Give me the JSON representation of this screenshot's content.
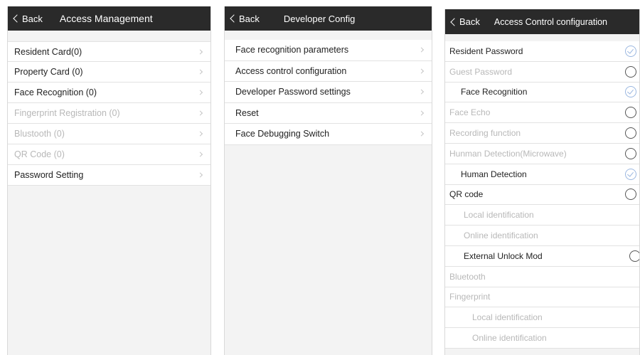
{
  "access_management": {
    "back_label": "Back",
    "title": "Access Management",
    "items": [
      {
        "label": "Resident Card(0)"
      },
      {
        "label": "Property Card (0)"
      },
      {
        "label": "Face Recognition (0)"
      },
      {
        "label": "Fingerprint Registration (0)"
      },
      {
        "label": "Blustooth (0)"
      },
      {
        "label": "QR Code (0)"
      },
      {
        "label": "Password Setting"
      }
    ]
  },
  "developer_config": {
    "back_label": "Back",
    "title": "Developer Config",
    "items": [
      {
        "label": "Face recognition parameters"
      },
      {
        "label": "Access control configuration"
      },
      {
        "label": "Developer Password settings"
      },
      {
        "label": "Reset"
      },
      {
        "label": "Face Debugging Switch"
      }
    ]
  },
  "access_control_configuration": {
    "back_label": "Back",
    "title": "Access Control configuration",
    "items": [
      {
        "label": "Resident Password",
        "checked": true
      },
      {
        "label": "Guest Password",
        "checked": false
      },
      {
        "label": "Face Recognition",
        "checked": true
      },
      {
        "label": "Face Echo",
        "checked": false
      },
      {
        "label": "Recording function",
        "checked": false
      },
      {
        "label": "Hunman Detection(Microwave)",
        "checked": false
      },
      {
        "label": "Human Detection",
        "checked": true
      },
      {
        "label": "QR code",
        "checked": false
      },
      {
        "label": "Local identification"
      },
      {
        "label": "Online identification"
      },
      {
        "label": "External Unlock Mod",
        "checked": false
      },
      {
        "label": "Bluetooth"
      },
      {
        "label": "Fingerprint"
      },
      {
        "label": "Local identification"
      },
      {
        "label": "Online identification"
      }
    ]
  }
}
